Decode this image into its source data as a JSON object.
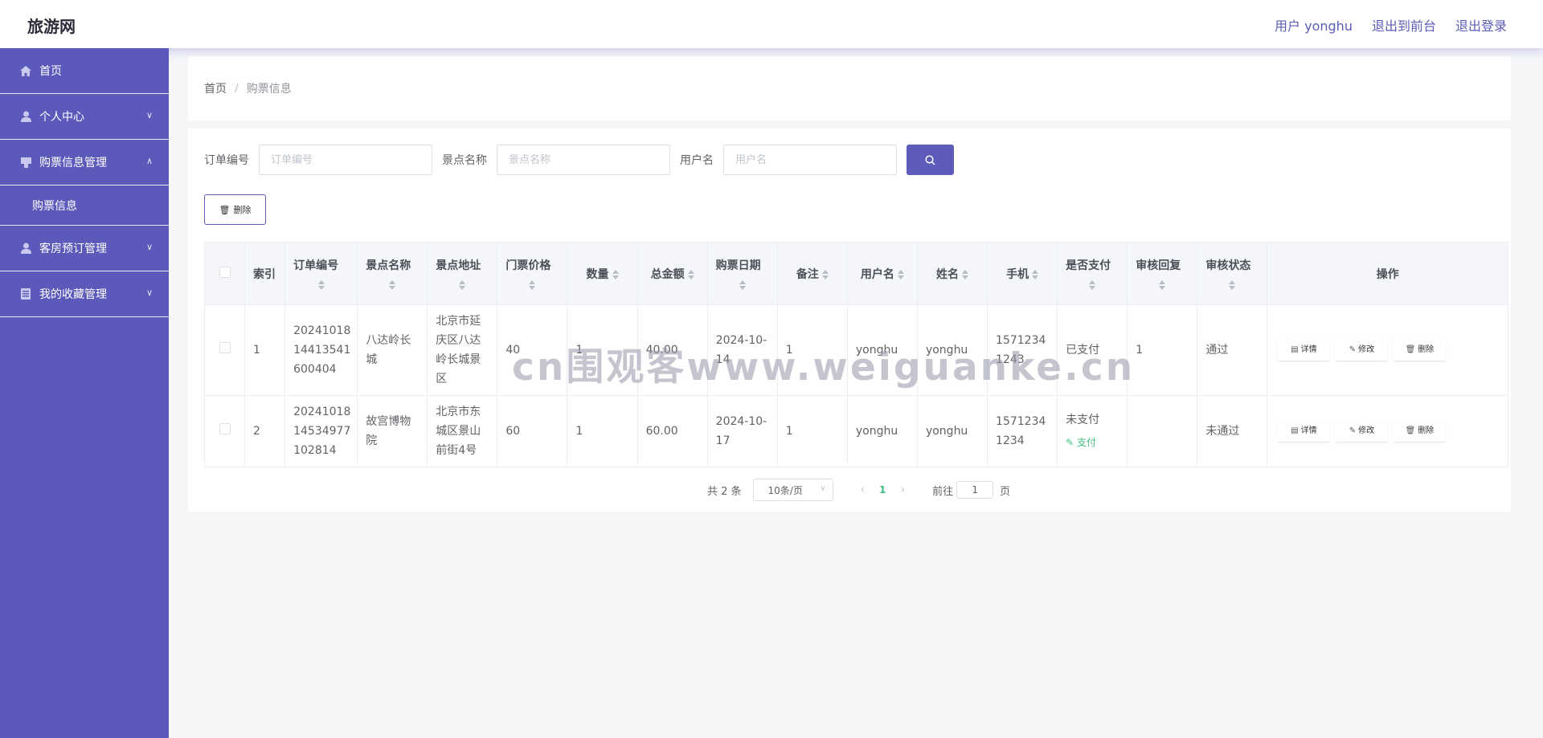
{
  "header": {
    "brand": "旅游网",
    "user_label": "用户 yonghu",
    "front_label": "退出到前台",
    "logout_label": "退出登录"
  },
  "sidebar": {
    "items": [
      {
        "label": "首页",
        "icon": "home-icon"
      },
      {
        "label": "个人中心",
        "icon": "user-icon"
      },
      {
        "label": "购票信息管理",
        "icon": "ticket-icon"
      },
      {
        "label": "购票信息",
        "icon": ""
      },
      {
        "label": "客房预订管理",
        "icon": "user-icon"
      },
      {
        "label": "我的收藏管理",
        "icon": "collection-icon"
      }
    ]
  },
  "breadcrumb": {
    "home": "首页",
    "sep": "/",
    "current": "购票信息"
  },
  "search": {
    "order_label": "订单编号",
    "order_placeholder": "订单编号",
    "spot_label": "景点名称",
    "spot_placeholder": "景点名称",
    "user_label": "用户名",
    "user_placeholder": "用户名"
  },
  "toolbar": {
    "delete_label": "删除"
  },
  "table": {
    "headers": [
      "索引",
      "订单编号",
      "景点名称",
      "景点地址",
      "门票价格",
      "数量",
      "总金额",
      "购票日期",
      "备注",
      "用户名",
      "姓名",
      "手机",
      "是否支付",
      "审核回复",
      "审核状态",
      "操作"
    ],
    "rows": [
      {
        "index": "1",
        "order": "20241018 14413541 600404",
        "spot": "八达岭长城",
        "address": "北京市延庆区八达岭长城景区",
        "price": "40",
        "qty": "1",
        "total": "40.00",
        "date": "2024-10-14",
        "note": "1",
        "username": "yonghu",
        "name": "yonghu",
        "phone": "15712341243",
        "paid": "已支付",
        "pay_action": "",
        "reply": "1",
        "status": "通过"
      },
      {
        "index": "2",
        "order": "20241018 14534977 102814",
        "spot": "故宫博物院",
        "address": "北京市东城区景山前街4号",
        "price": "60",
        "qty": "1",
        "total": "60.00",
        "date": "2024-10-17",
        "note": "1",
        "username": "yonghu",
        "name": "yonghu",
        "phone": "15712341234",
        "paid": "未支付",
        "pay_action": "支付",
        "reply": "",
        "status": "未通过"
      }
    ],
    "ops": {
      "detail": "详情",
      "edit": "修改",
      "delete": "删除"
    }
  },
  "pager": {
    "total": "共 2 条",
    "size": "10条/页",
    "current": "1",
    "goto_label": "前往",
    "goto_value": "1",
    "page_suffix": "页"
  },
  "watermark": "cn围观客www.weiguanke.cn"
}
